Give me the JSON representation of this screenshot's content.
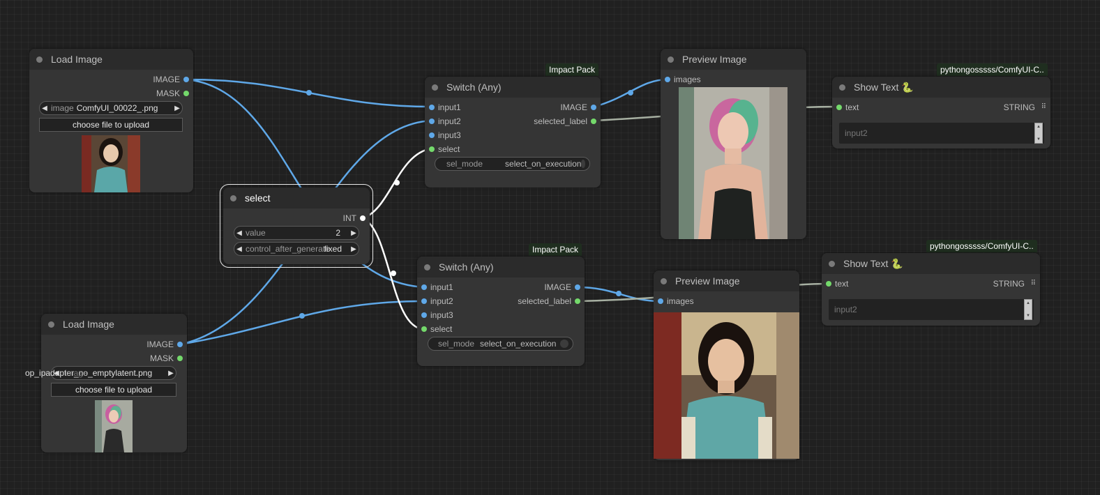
{
  "nodes": {
    "load1": {
      "title": "Load Image",
      "out_image": "IMAGE",
      "out_mask": "MASK",
      "w_image_name": "image",
      "w_image_value": "ComfyUI_00022_.png",
      "upload": "choose file to upload"
    },
    "load2": {
      "title": "Load Image",
      "out_image": "IMAGE",
      "out_mask": "MASK",
      "w_image_prefix": "op_ipadapter_no_emptylatent.png",
      "w_image_overlay": "image",
      "upload": "choose file to upload"
    },
    "select": {
      "title": "select",
      "out_int": "INT",
      "w_value_name": "value",
      "w_value": "2",
      "w_cag_name": "control_after_generate",
      "w_cag_value": "fixed"
    },
    "switch1": {
      "badge": "Impact Pack",
      "title": "Switch (Any)",
      "in1": "input1",
      "in2": "input2",
      "in3": "input3",
      "in_select": "select",
      "out_image": "IMAGE",
      "out_label": "selected_label",
      "w_selmode": "sel_mode",
      "w_selmode_value": "select_on_execution"
    },
    "switch2": {
      "badge": "Impact Pack",
      "title": "Switch (Any)",
      "in1": "input1",
      "in2": "input2",
      "in3": "input3",
      "in_select": "select",
      "out_image": "IMAGE",
      "out_label": "selected_label",
      "w_selmode": "sel_mode",
      "w_selmode_value": "select_on_execution"
    },
    "preview1": {
      "title": "Preview Image",
      "in_images": "images"
    },
    "preview2": {
      "title": "Preview Image",
      "in_images": "images"
    },
    "show1": {
      "badge": "pythongosssss/ComfyUI-C..",
      "title": "Show Text 🐍",
      "in_text": "text",
      "out_string": "STRING",
      "text_value": "input2"
    },
    "show2": {
      "badge": "pythongosssss/ComfyUI-C..",
      "title": "Show Text 🐍",
      "in_text": "text",
      "out_string": "STRING",
      "text_value": "input2"
    }
  },
  "colors": {
    "image_link": "#5fa8e8",
    "int_link": "#ffffff",
    "string_link": "#a7b0a2",
    "badge_bg": "#1f2e1f"
  }
}
